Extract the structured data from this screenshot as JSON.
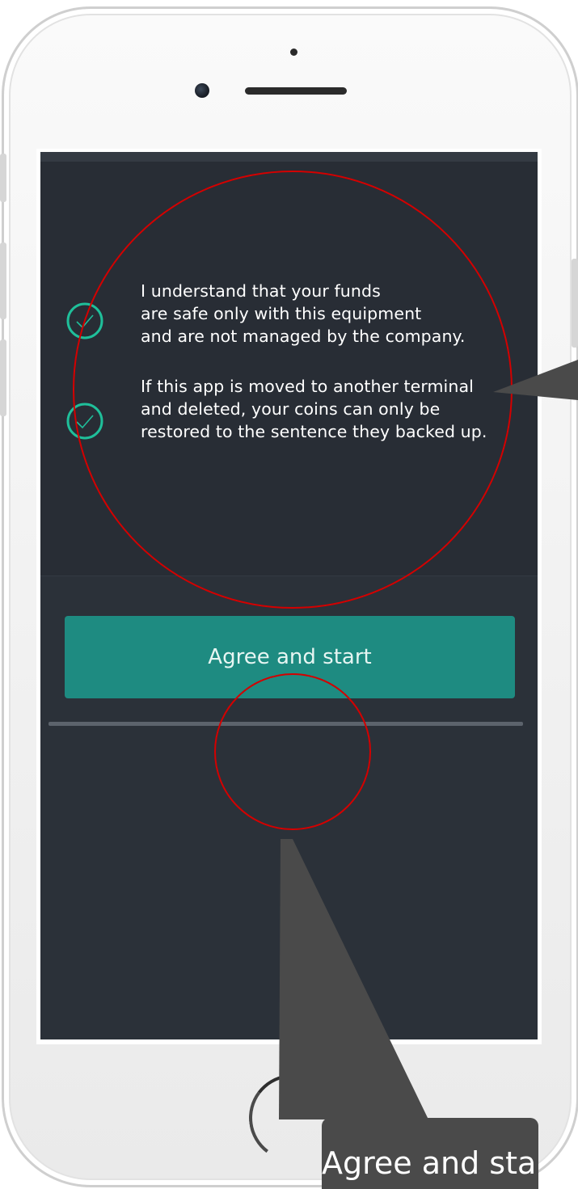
{
  "agreements": [
    {
      "text": "I understand that your funds\nare safe only with this equipment\nand are not managed by the company.",
      "icon": "check-circle-icon"
    },
    {
      "text": "If this app is moved to another terminal\nand deleted, your coins can only be\nrestored to the sentence they backed up.",
      "icon": "check-circle-icon"
    }
  ],
  "primary_button": {
    "label": "Agree and start"
  },
  "annotation": {
    "callout_label": "Agree and start"
  },
  "colors": {
    "screen_background": "#282d35",
    "accent": "#1e8b81",
    "check_icon": "#1fbf9a",
    "annotation_circle": "#d40000",
    "callout_background": "#4a4a4a"
  }
}
